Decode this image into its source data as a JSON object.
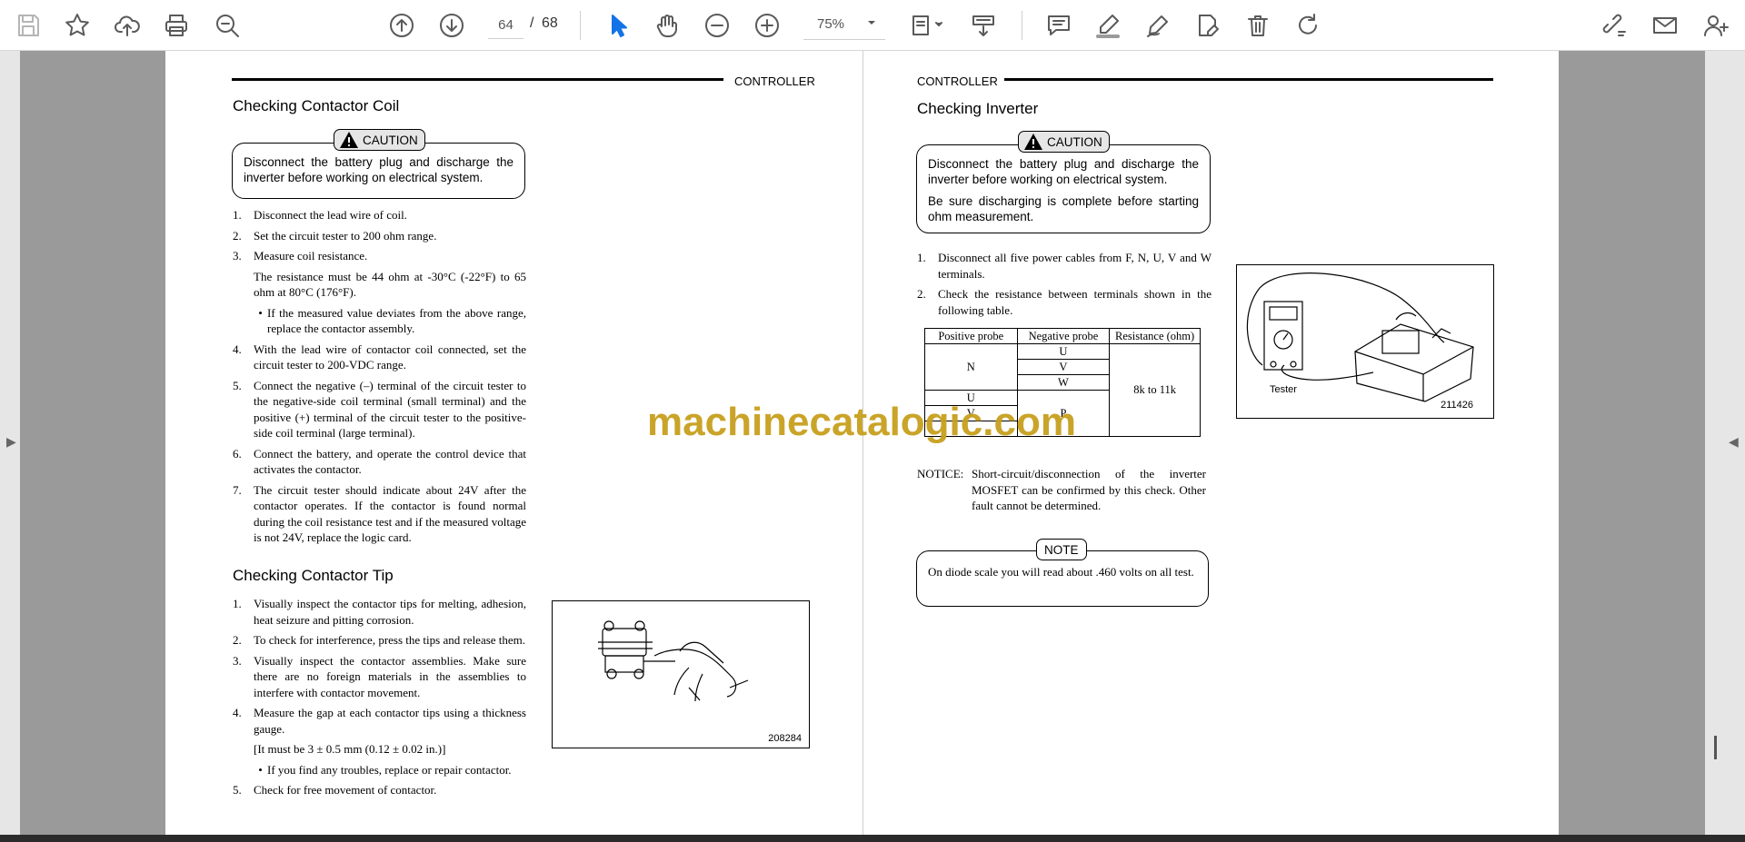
{
  "toolbar": {
    "current_page": "64",
    "page_separator": "/",
    "total_pages": "68",
    "zoom": "75%"
  },
  "left_page": {
    "header": "CONTROLLER",
    "coil_section": {
      "title": "Checking Contactor Coil",
      "caution_label": "CAUTION",
      "caution_text": "Disconnect the battery plug and discharge the inverter before working on electrical system.",
      "steps": [
        {
          "num": "1.",
          "text": "Disconnect the lead wire of coil."
        },
        {
          "num": "2.",
          "text": "Set the circuit tester to 200 ohm range."
        },
        {
          "num": "3.",
          "text": "Measure coil resistance."
        }
      ],
      "resistance_note": "The resistance must be 44 ohm at -30°C (-22°F) to 65 ohm at 80°C (176°F).",
      "deviation_bullet": "If the measured value deviates from the above range, replace the contactor assembly.",
      "steps_b": [
        {
          "num": "4.",
          "text": "With the lead wire of contactor coil connected, set the circuit tester to 200-VDC range."
        },
        {
          "num": "5.",
          "text": "Connect the negative (–) terminal of the circuit tester to the negative-side coil terminal (small terminal) and the positive (+) terminal of the circuit tester to the positive-side coil terminal (large terminal)."
        },
        {
          "num": "6.",
          "text": "Connect the battery, and operate the control device that activates the contactor."
        },
        {
          "num": "7.",
          "text": "The circuit tester should indicate about 24V after the contactor operates.  If the contactor is found normal during the coil resistance test and if the measured voltage is not 24V, replace the logic card."
        }
      ]
    },
    "tip_section": {
      "title": "Checking Contactor Tip",
      "steps": [
        {
          "num": "1.",
          "text": "Visually inspect the contactor tips for melting, adhesion, heat seizure and pitting corrosion."
        },
        {
          "num": "2.",
          "text": "To check for interference, press the tips and release them."
        },
        {
          "num": "3.",
          "text": "Visually inspect the contactor assemblies.  Make sure there are no foreign materials in the assemblies to interfere with contactor movement."
        },
        {
          "num": "4.",
          "text": "Measure the gap at each contactor tips using a thickness gauge."
        }
      ],
      "gap_spec": "[It must be 3 ± 0.5 mm (0.12 ± 0.02 in.)]",
      "trouble_bullet": "If you find any troubles, replace or repair contactor.",
      "step5": {
        "num": "5.",
        "text": "Check for free movement of contactor."
      },
      "figure_code": "208284"
    }
  },
  "right_page": {
    "header": "CONTROLLER",
    "title": "Checking Inverter",
    "caution_label": "CAUTION",
    "caution_text_1": "Disconnect the battery plug and discharge the inverter before working on electrical system.",
    "caution_text_2": "Be sure discharging is complete before starting ohm measurement.",
    "steps": [
      {
        "num": "1.",
        "text": "Disconnect all five power cables from F, N, U, V and W terminals."
      },
      {
        "num": "2.",
        "text": "Check the resistance between terminals shown in the following table."
      }
    ],
    "table": {
      "headers": [
        "Positive probe",
        "Negative probe",
        "Resistance (ohm)"
      ],
      "pos_n": "N",
      "neg": [
        "U",
        "V",
        "W"
      ],
      "resistance": "8k to 11k",
      "pos_u": "U",
      "pos_v": "V",
      "neg_p": "P"
    },
    "notice_label": "NOTICE:",
    "notice_text": "Short-circuit/disconnection of the inverter MOSFET can be confirmed by this check. Other fault cannot be determined.",
    "note_label": "NOTE",
    "note_text": "On diode scale you will read about .460 volts on all test.",
    "figure_label": "Tester",
    "figure_code": "211426"
  },
  "watermark": "machinecatalogic.com"
}
